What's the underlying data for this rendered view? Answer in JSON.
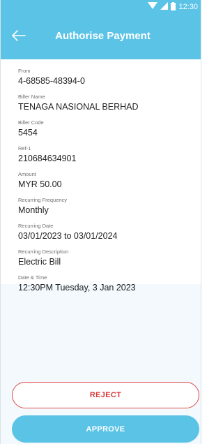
{
  "status_bar": {
    "time": "12:30",
    "icons": [
      "wifi-icon",
      "signal-icon",
      "battery-icon"
    ]
  },
  "header": {
    "title": "Authorise Payment",
    "back_icon": "arrow-left-icon"
  },
  "details": [
    {
      "label": "From",
      "value": "4-68585-48394-0"
    },
    {
      "label": "Biller Name",
      "value": "TENAGA NASIONAL BERHAD"
    },
    {
      "label": "Biller Code",
      "value": "5454"
    },
    {
      "label": "Ref-1",
      "value": "210684634901"
    },
    {
      "label": "Amount",
      "value": "MYR 50.00"
    },
    {
      "label": "Recurring Frequency",
      "value": "Monthly"
    },
    {
      "label": "Recurring Date",
      "value": "03/01/2023 to 03/01/2024"
    },
    {
      "label": "Recurring Description",
      "value": "Electric Bill"
    },
    {
      "label": "Date & Time",
      "value": "12:30PM Tuesday, 3 Jan 2023"
    }
  ],
  "actions": {
    "reject_label": "REJECT",
    "approve_label": "APPROVE"
  },
  "colors": {
    "primary": "#5bc3e6",
    "reject": "#d93a3a",
    "page_background": "#f3f9fd"
  }
}
